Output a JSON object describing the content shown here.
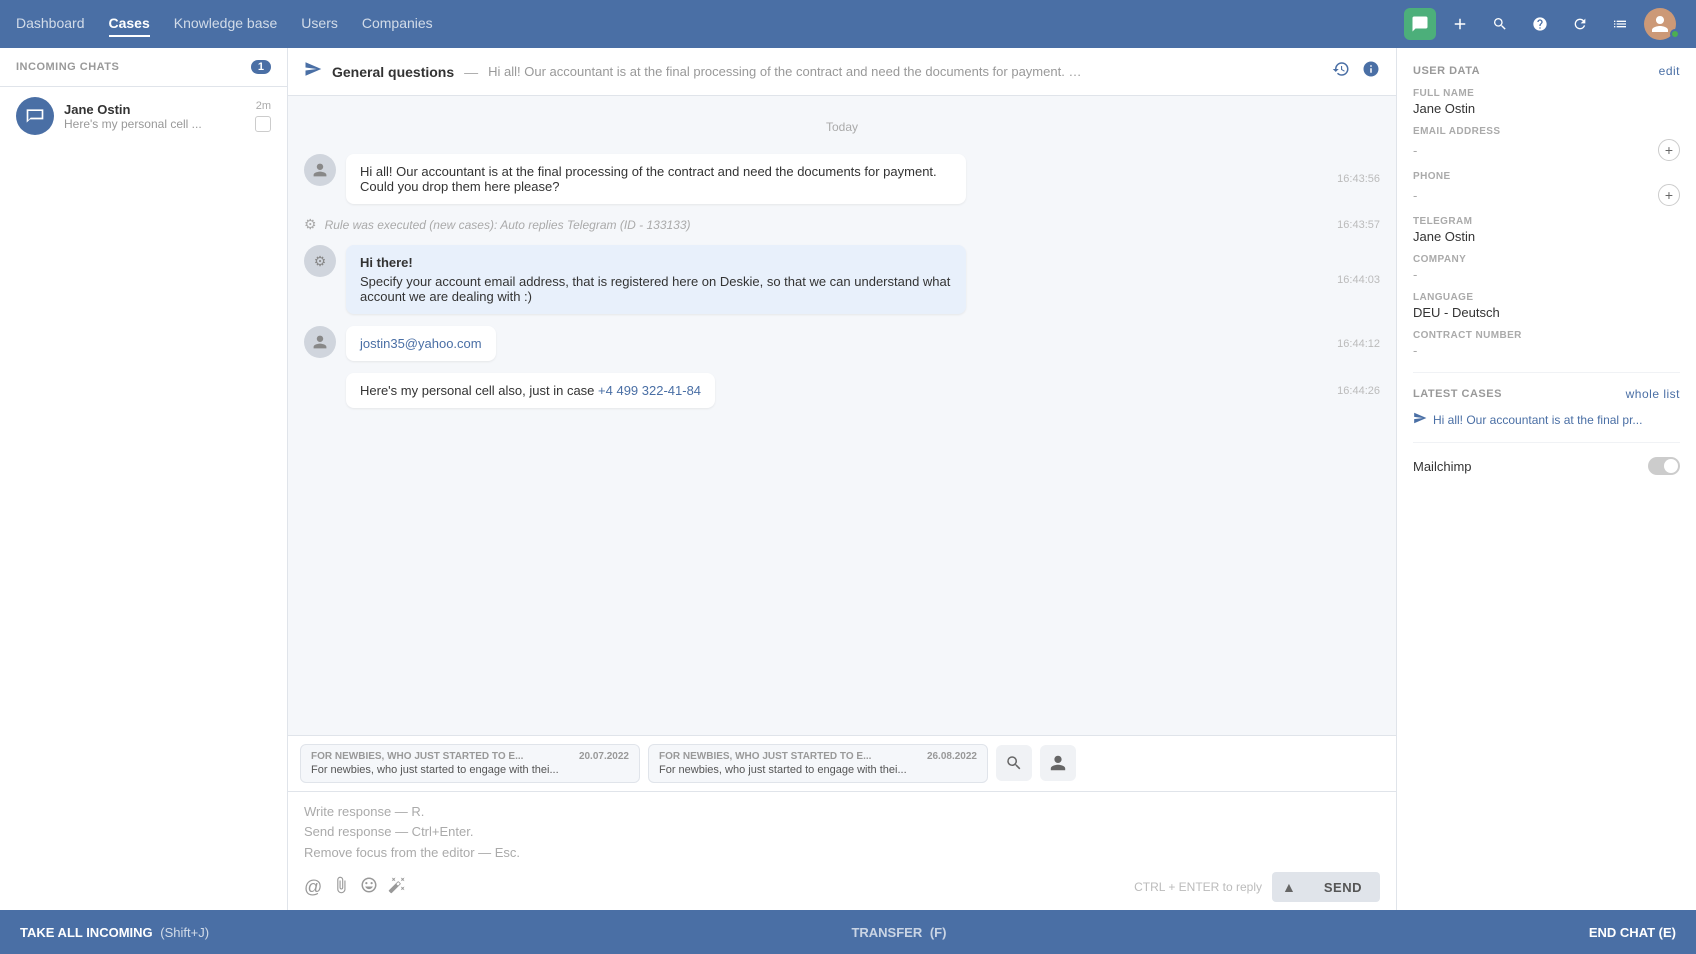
{
  "nav": {
    "links": [
      {
        "label": "Dashboard",
        "active": false
      },
      {
        "label": "Cases",
        "active": true
      },
      {
        "label": "Knowledge base",
        "active": false
      },
      {
        "label": "Users",
        "active": false
      },
      {
        "label": "Companies",
        "active": false
      }
    ]
  },
  "sidebar": {
    "title": "INCOMING CHATS",
    "badge": "1",
    "chat": {
      "name": "Jane Ostin",
      "preview": "Here's my personal cell ...",
      "time": "2m"
    }
  },
  "chat_header": {
    "title": "General questions",
    "separator": " — ",
    "preview": "Hi all! Our accountant is at the final processing of the contract and need the documents for payment. Could yo..."
  },
  "date_divider": "Today",
  "messages": [
    {
      "id": "msg1",
      "type": "user",
      "text": "Hi all! Our accountant is at the final processing of the contract and need the documents for payment. Could you drop them here please?",
      "time": "16:43:56"
    },
    {
      "id": "msg2",
      "type": "system",
      "text": "Rule was executed (new cases): Auto replies Telegram (ID - 133133)",
      "time": "16:43:57"
    },
    {
      "id": "msg3",
      "type": "bot",
      "title": "Hi there!",
      "text": "Specify your account email address, that is registered here on Deskie, so that we can understand what account we are dealing with :)",
      "time": "16:44:03"
    },
    {
      "id": "msg4",
      "type": "user_link",
      "text": "jostin35@yahoo.com",
      "time": "16:44:12"
    },
    {
      "id": "msg5",
      "type": "user_plain",
      "text": "Here's my personal cell also, just in case ",
      "link": "+4 499 322-41-84",
      "time": "16:44:26"
    }
  ],
  "templates": [
    {
      "header": "FOR NEWBIES, WHO JUST STARTED TO E...",
      "date": "20.07.2022",
      "body": "For newbies, who just started to engage with thei..."
    },
    {
      "header": "FOR NEWBIES, WHO JUST STARTED TO E...",
      "date": "26.08.2022",
      "body": "For newbies, who just started to engage with thei..."
    }
  ],
  "compose": {
    "placeholder_line1": "Write response — R.",
    "placeholder_line2": "Send response — Ctrl+Enter.",
    "placeholder_line3": "Remove focus from the editor — Esc.",
    "ctrl_hint": "CTRL + ENTER to reply",
    "send_label": "SEND"
  },
  "user_data": {
    "section_title": "USER DATA",
    "edit_label": "edit",
    "full_name_label": "FULL NAME",
    "full_name": "Jane Ostin",
    "email_label": "EMAIL ADDRESS",
    "email": "-",
    "phone_label": "PHONE",
    "phone": "-",
    "telegram_label": "TELEGRAM",
    "telegram": "Jane Ostin",
    "company_label": "COMPANY",
    "company": "-",
    "language_label": "LANGUAGE",
    "language": "DEU - Deutsch",
    "contract_label": "CONTRACT NUMBER",
    "contract": "-",
    "latest_cases_label": "LATEST CASES",
    "whole_list_label": "whole list",
    "latest_case_text": "Hi all! Our accountant is at the final pr...",
    "mailchimp_label": "Mailchimp"
  },
  "bottom_bar": {
    "take_all": "TAKE ALL INCOMING",
    "take_all_shortcut": "(Shift+J)",
    "transfer": "TRANSFER",
    "transfer_shortcut": "(F)",
    "end_chat": "END CHAT (E)"
  }
}
